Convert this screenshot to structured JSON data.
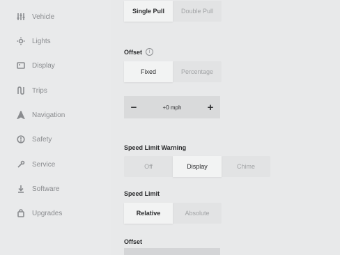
{
  "sidebar": {
    "items": [
      {
        "label": "Vehicle",
        "icon": "sliders-icon"
      },
      {
        "label": "Lights",
        "icon": "lightbulb-icon"
      },
      {
        "label": "Display",
        "icon": "display-icon"
      },
      {
        "label": "Trips",
        "icon": "trips-icon"
      },
      {
        "label": "Navigation",
        "icon": "navigation-arrow-icon"
      },
      {
        "label": "Safety",
        "icon": "safety-icon"
      },
      {
        "label": "Service",
        "icon": "wrench-icon"
      },
      {
        "label": "Software",
        "icon": "download-icon"
      },
      {
        "label": "Upgrades",
        "icon": "bag-icon"
      }
    ]
  },
  "pull_mode": {
    "options": [
      "Single Pull",
      "Double Pull"
    ],
    "selected": "Single Pull"
  },
  "offset_1": {
    "label": "Offset",
    "info_icon": "i",
    "options": [
      "Fixed",
      "Percentage"
    ],
    "selected": "Fixed"
  },
  "stepper": {
    "minus": "−",
    "value": "+0 mph",
    "plus": "+"
  },
  "speed_limit_warning": {
    "label": "Speed Limit Warning",
    "options": [
      "Off",
      "Display",
      "Chime"
    ],
    "selected": "Display"
  },
  "speed_limit": {
    "label": "Speed Limit",
    "options": [
      "Relative",
      "Absolute"
    ],
    "selected": "Relative"
  },
  "offset_2": {
    "label": "Offset"
  },
  "colors": {
    "background": "#e8e9ea",
    "selected": "#f2f3f3",
    "text": "#2b2c2e",
    "muted": "#a2a4a6"
  }
}
